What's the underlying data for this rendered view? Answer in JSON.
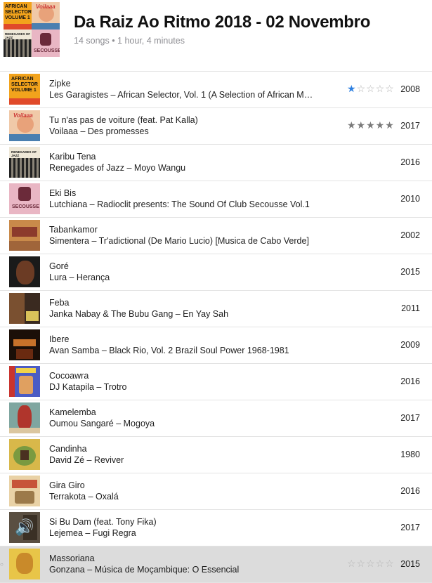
{
  "playlist": {
    "title": "Da Raiz Ao Ritmo 2018 - 02 Novembro",
    "meta": "14 songs • 1 hour, 4 minutes"
  },
  "colors": {
    "accent_star": "#2d7fe0",
    "row_divider": "#e3e3e3",
    "selected_row": "#dcdcdc"
  },
  "cover_texts": {
    "african_selector": [
      "AFRICAN",
      "SELECTOR",
      "VOLUME 1"
    ],
    "renegades": "RENEGADES OF JAZZ",
    "secousse": "SECOUSSE",
    "voilaaa": "Voilaaa"
  },
  "tracks": [
    {
      "title": "Zipke",
      "subtitle": "Les Garagistes – African Selector, Vol. 1 (A Selection of African M…",
      "year": "2008",
      "rating_stars": 1,
      "rating_style": "blue-partial",
      "art_icon": "african-selector-cover"
    },
    {
      "title": "Tu n'as pas de voiture (feat. Pat Kalla)",
      "subtitle": "Voilaaa – Des promesses",
      "year": "2017",
      "rating_stars": 5,
      "rating_style": "gray-full",
      "art_icon": "voilaaa-cover"
    },
    {
      "title": "Karibu Tena",
      "subtitle": "Renegades of Jazz – Moyo Wangu",
      "year": "2016",
      "art_icon": "renegades-cover"
    },
    {
      "title": "Eki Bis",
      "subtitle": "Lutchiana – Radioclit presents: The Sound Of Club Secousse Vol.1",
      "year": "2010",
      "art_icon": "secousse-cover"
    },
    {
      "title": "Tabankamor",
      "subtitle": "Simentera – Tr'adictional (De Mario Lucio) [Musica de Cabo Verde]",
      "year": "2002",
      "art_icon": "simentera-cover"
    },
    {
      "title": "Goré",
      "subtitle": "Lura – Herança",
      "year": "2015",
      "art_icon": "lura-cover"
    },
    {
      "title": "Feba",
      "subtitle": "Janka Nabay & The Bubu Gang – En Yay Sah",
      "year": "2011",
      "art_icon": "janka-cover"
    },
    {
      "title": "Ibere",
      "subtitle": "Avan Samba – Black Rio, Vol. 2 Brazil Soul Power 1968-1981",
      "year": "2009",
      "art_icon": "black-rio-cover"
    },
    {
      "title": "Cocoawra",
      "subtitle": "DJ Katapila – Trotro",
      "year": "2016",
      "art_icon": "trotro-cover"
    },
    {
      "title": "Kamelemba",
      "subtitle": "Oumou Sangaré – Mogoya",
      "year": "2017",
      "art_icon": "mogoya-cover"
    },
    {
      "title": "Candinha",
      "subtitle": "David Zé – Reviver",
      "year": "1980",
      "art_icon": "reviver-cover"
    },
    {
      "title": "Gira Giro",
      "subtitle": "Terrakota – Oxalá",
      "year": "2016",
      "art_icon": "oxala-cover"
    },
    {
      "title": "Si Bu Dam (feat. Tony Fika)",
      "subtitle": "Lejemea – Fugi Regra",
      "year": "2017",
      "art_icon": "fugi-regra-cover",
      "now_playing": true
    },
    {
      "title": "Massoriana",
      "subtitle": "Gonzana – Música de Moçambique: O Essencial",
      "year": "2015",
      "rating_stars": 0,
      "rating_style": "empty",
      "art_icon": "mocambique-cover",
      "selected": true
    }
  ]
}
